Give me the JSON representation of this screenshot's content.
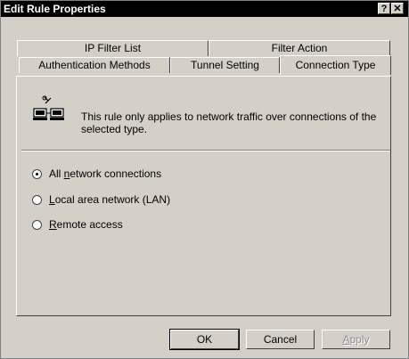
{
  "window": {
    "title": "Edit Rule Properties",
    "help_label": "?",
    "close_label": "✕"
  },
  "tabs": {
    "row1": [
      {
        "label": "IP Filter List"
      },
      {
        "label": "Filter Action"
      }
    ],
    "row2": [
      {
        "label": "Authentication Methods"
      },
      {
        "label": "Tunnel Setting"
      },
      {
        "label": "Connection Type",
        "active": true
      }
    ]
  },
  "panel": {
    "icon": "network-computers-icon",
    "description": "This rule only applies to network traffic over connections of the selected type.",
    "options": [
      {
        "label_prefix": "All ",
        "label_accel": "n",
        "label_suffix": "etwork connections",
        "checked": true
      },
      {
        "label_prefix": "",
        "label_accel": "L",
        "label_suffix": "ocal area network (LAN)",
        "checked": false
      },
      {
        "label_prefix": "",
        "label_accel": "R",
        "label_suffix": "emote access",
        "checked": false
      }
    ]
  },
  "buttons": {
    "ok": "OK",
    "cancel": "Cancel",
    "apply_accel": "A",
    "apply_rest": "pply"
  }
}
